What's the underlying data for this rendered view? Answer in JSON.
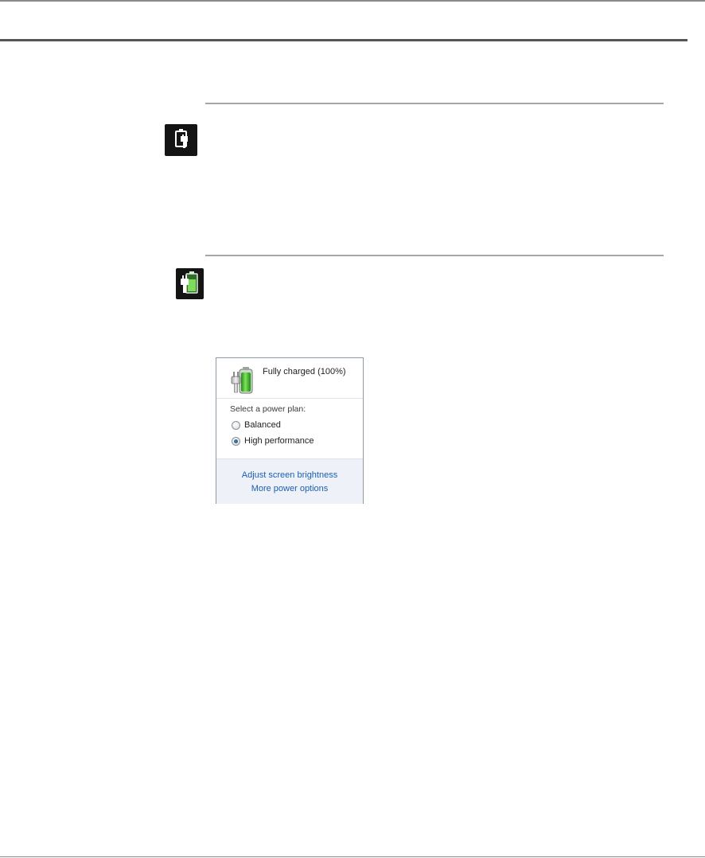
{
  "tray_icons": {
    "plugged_in": "plug-battery-icon",
    "charging": "charging-battery-icon"
  },
  "power_popup": {
    "battery_icon": "battery-plug-icon",
    "status": "Fully charged (100%)",
    "battery_level_percent": 100,
    "plan_heading": "Select a power plan:",
    "plans": [
      {
        "label": "Balanced",
        "selected": false
      },
      {
        "label": "High performance",
        "selected": true
      }
    ],
    "links": {
      "brightness": "Adjust screen brightness",
      "more_options": "More power options"
    }
  },
  "colors": {
    "link": "#1a5fb4",
    "battery_green": "#3fbf2e",
    "tray_background": "#141414"
  }
}
